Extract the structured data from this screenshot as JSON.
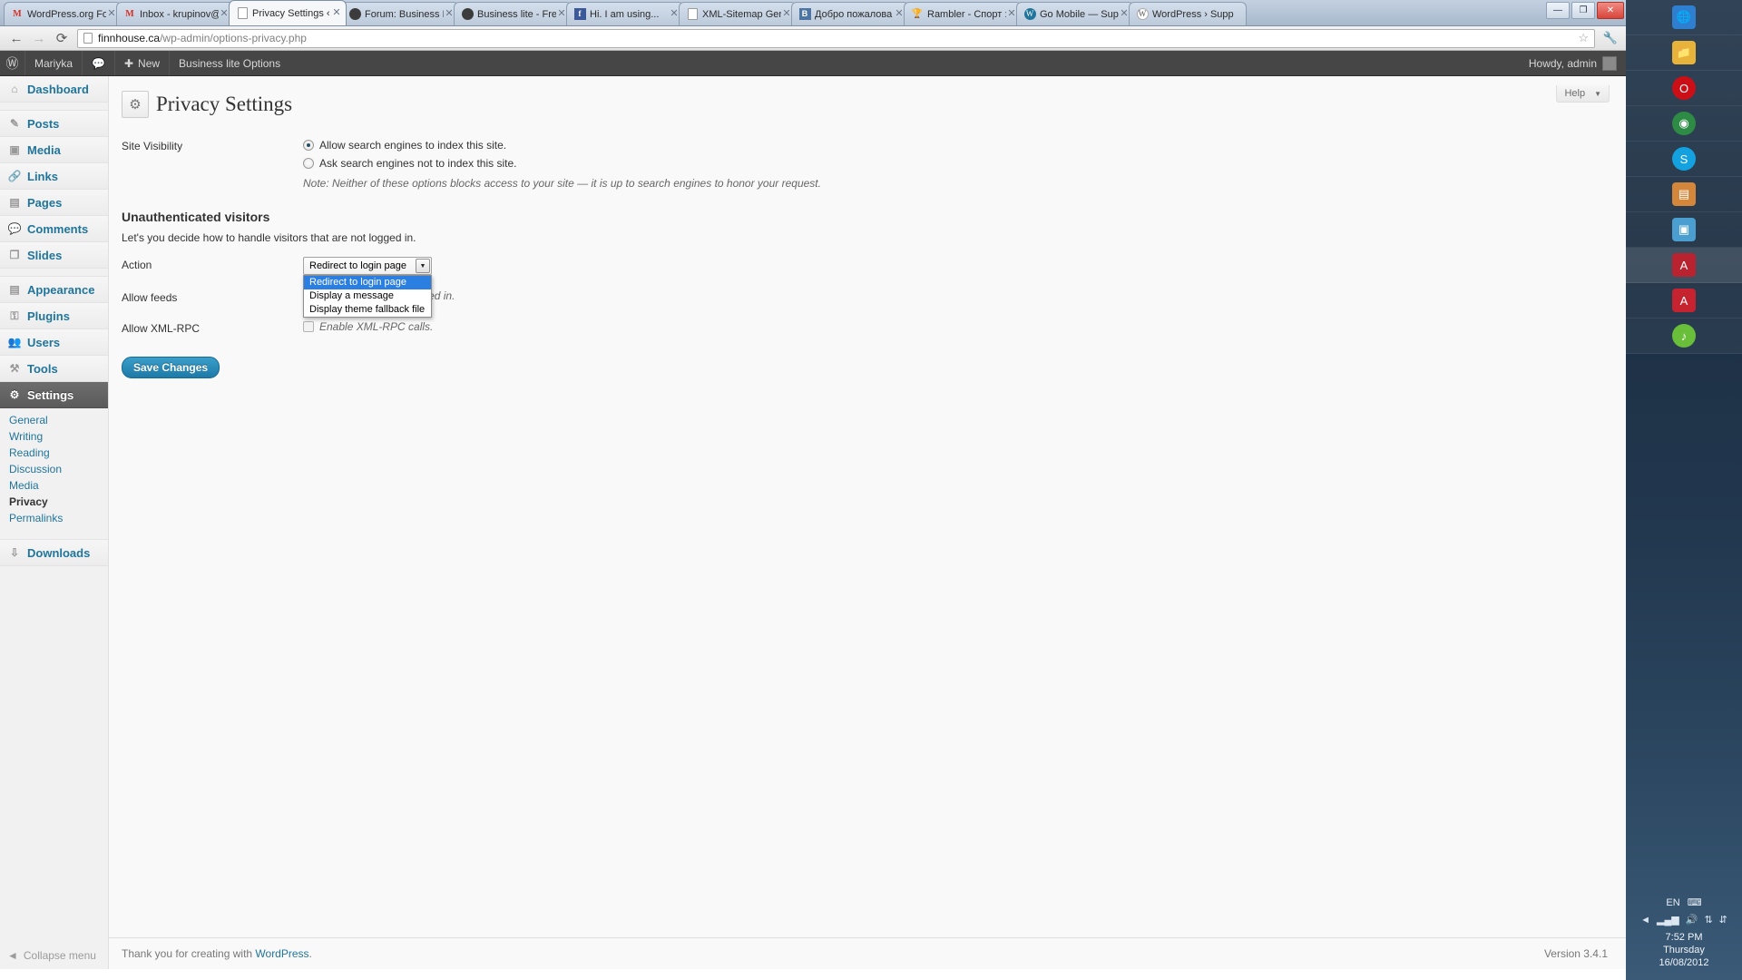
{
  "browser": {
    "tabs": [
      {
        "title": "WordPress.org For",
        "favicon": "gmail-icon",
        "active": false
      },
      {
        "title": "Inbox - krupinov@",
        "favicon": "gmail-icon",
        "active": false
      },
      {
        "title": "Privacy Settings ‹ M",
        "favicon": "document-icon",
        "active": true
      },
      {
        "title": "Forum: Business Li",
        "favicon": "forum-icon",
        "active": false
      },
      {
        "title": "Business lite - Free",
        "favicon": "forum-icon",
        "active": false
      },
      {
        "title": "Hi. I am using...",
        "favicon": "facebook-icon",
        "active": false
      },
      {
        "title": "XML-Sitemap Gen",
        "favicon": "document-icon",
        "active": false
      },
      {
        "title": "Добро пожалова",
        "favicon": "vk-icon",
        "active": false
      },
      {
        "title": "Rambler - Спорт :",
        "favicon": "trophy-icon",
        "active": false
      },
      {
        "title": "Go Mobile — Supp",
        "favicon": "wordpress-icon",
        "active": false
      },
      {
        "title": "WordPress › Supp",
        "favicon": "wordpress-gray-icon",
        "active": false
      }
    ],
    "tab_close_glyph": "✕",
    "window_controls": {
      "minimize": "—",
      "maximize": "❐",
      "close": "✕"
    },
    "nav": {
      "back": "←",
      "forward": "→",
      "reload": "⟳"
    },
    "url_host": "finnhouse.ca",
    "url_path": "/wp-admin/options-privacy.php",
    "star_glyph": "☆",
    "wrench_glyph": "🔧"
  },
  "adminbar": {
    "logo": "Ⓦ",
    "site_name": "Mariyka",
    "comments_glyph": "💬",
    "new_label": "New",
    "new_glyph": "✚",
    "theme_options": "Business lite Options",
    "howdy": "Howdy, admin"
  },
  "sidebar": {
    "items": [
      {
        "label": "Dashboard",
        "icon": "home-icon",
        "glyph": "⌂",
        "current": false
      },
      {
        "label": "Posts",
        "icon": "pin-icon",
        "glyph": "✎",
        "current": false
      },
      {
        "label": "Media",
        "icon": "media-icon",
        "glyph": "▣",
        "current": false
      },
      {
        "label": "Links",
        "icon": "link-icon",
        "glyph": "🔗",
        "current": false
      },
      {
        "label": "Pages",
        "icon": "pages-icon",
        "glyph": "▤",
        "current": false
      },
      {
        "label": "Comments",
        "icon": "comment-icon",
        "glyph": "💬",
        "current": false
      },
      {
        "label": "Slides",
        "icon": "slides-icon",
        "glyph": "❐",
        "current": false
      },
      {
        "label": "Appearance",
        "icon": "appearance-icon",
        "glyph": "▤",
        "current": false
      },
      {
        "label": "Plugins",
        "icon": "plugin-icon",
        "glyph": "⚿",
        "current": false
      },
      {
        "label": "Users",
        "icon": "users-icon",
        "glyph": "👥",
        "current": false
      },
      {
        "label": "Tools",
        "icon": "tools-icon",
        "glyph": "⚒",
        "current": false
      },
      {
        "label": "Settings",
        "icon": "settings-icon",
        "glyph": "⚙",
        "current": true
      }
    ],
    "submenu": [
      {
        "label": "General",
        "current": false
      },
      {
        "label": "Writing",
        "current": false
      },
      {
        "label": "Reading",
        "current": false
      },
      {
        "label": "Discussion",
        "current": false
      },
      {
        "label": "Media",
        "current": false
      },
      {
        "label": "Privacy",
        "current": true
      },
      {
        "label": "Permalinks",
        "current": false
      }
    ],
    "downloads": {
      "label": "Downloads",
      "glyph": "⇩"
    },
    "collapse": {
      "label": "Collapse menu",
      "glyph": "◄"
    }
  },
  "page": {
    "help_label": "Help",
    "help_caret": "▼",
    "title": "Privacy Settings",
    "title_icon_glyph": "⚙",
    "site_visibility": {
      "label": "Site Visibility",
      "option_allow": "Allow search engines to index this site.",
      "option_ask": "Ask search engines not to index this site.",
      "selected": "allow",
      "note": "Note: Neither of these options blocks access to your site — it is up to search engines to honor your request."
    },
    "unauthenticated": {
      "heading": "Unauthenticated visitors",
      "description": "Let's you decide how to handle visitors that are not logged in.",
      "action": {
        "label": "Action",
        "value": "Redirect to login page",
        "open": true,
        "arrow_glyph": "▼",
        "options": [
          {
            "label": "Redirect to login page",
            "selected": true
          },
          {
            "label": "Display a message",
            "selected": false
          },
          {
            "label": "Display theme fallback file",
            "selected": false
          }
        ]
      },
      "feeds": {
        "label": "Allow feeds",
        "text_visible": "ds even when not logged in.",
        "checked": false
      },
      "xmlrpc": {
        "label": "Allow XML-RPC",
        "text": "Enable XML-RPC calls.",
        "checked": false
      }
    },
    "save_label": "Save Changes",
    "footer_text": "Thank you for creating with ",
    "footer_link": "WordPress",
    "footer_period": ".",
    "version": "Version 3.4.1"
  },
  "desktop": {
    "dock": [
      {
        "name": "globe-icon",
        "glyph": "🌐",
        "color": "#2f7fd0",
        "active": false
      },
      {
        "name": "folder-icon",
        "glyph": "📁",
        "color": "#e8b33a",
        "active": false
      },
      {
        "name": "opera-icon",
        "glyph": "O",
        "color": "#cc0f16",
        "active": false
      },
      {
        "name": "chrome-icon",
        "glyph": "◉",
        "color": "#2e8b45",
        "active": false
      },
      {
        "name": "skype-icon",
        "glyph": "S",
        "color": "#13a1e0",
        "active": false
      },
      {
        "name": "book-icon",
        "glyph": "▤",
        "color": "#d4873b",
        "active": false
      },
      {
        "name": "photos-icon",
        "glyph": "▣",
        "color": "#4a9fd0",
        "active": false
      },
      {
        "name": "acrobat-icon",
        "glyph": "A",
        "color": "#b8232f",
        "active": true
      },
      {
        "name": "reader-icon",
        "glyph": "A",
        "color": "#c4232f",
        "active": false
      },
      {
        "name": "music-icon",
        "glyph": "♪",
        "color": "#6abf3a",
        "active": false
      }
    ],
    "tray": {
      "language": "EN",
      "keyboard_glyph": "⌨",
      "expand_glyph": "◄",
      "icons": [
        "signal-icon",
        "volume-icon",
        "network-icon",
        "update-icon"
      ],
      "signal_glyph": "▂▄▆",
      "volume_glyph": "🔊",
      "network_glyph": "⇅",
      "update_glyph": "⇵",
      "time": "7:52 PM",
      "day": "Thursday",
      "date": "16/08/2012"
    }
  }
}
